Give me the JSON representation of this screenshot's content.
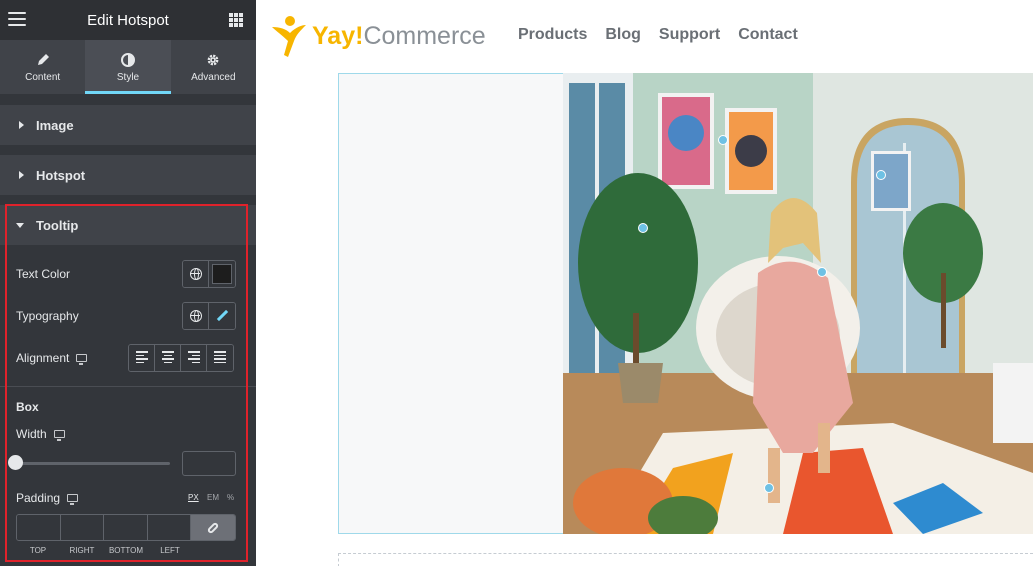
{
  "panel": {
    "title": "Edit Hotspot",
    "tabs": [
      {
        "label": "Content",
        "icon": "pencil-icon"
      },
      {
        "label": "Style",
        "icon": "half-circle-icon",
        "active": true
      },
      {
        "label": "Advanced",
        "icon": "gear-icon"
      }
    ],
    "sections": {
      "image": "Image",
      "hotspot": "Hotspot",
      "tooltip": "Tooltip"
    },
    "controls": {
      "text_color": "Text Color",
      "typography": "Typography",
      "alignment": "Alignment",
      "box_heading": "Box",
      "width": "Width",
      "padding": "Padding",
      "units": [
        "PX",
        "EM",
        "%"
      ],
      "dims": [
        "TOP",
        "RIGHT",
        "BOTTOM",
        "LEFT"
      ]
    },
    "colors": {
      "text_color_swatch": "#1d1d1d",
      "accent": "#71d7f7",
      "highlight_box": "#e0222b"
    }
  },
  "site": {
    "logo": {
      "brand_a": "Yay!",
      "brand_b": "Commerce"
    },
    "nav": [
      "Products",
      "Blog",
      "Support",
      "Contact"
    ],
    "hotspot_color": "#6ec1e4"
  }
}
